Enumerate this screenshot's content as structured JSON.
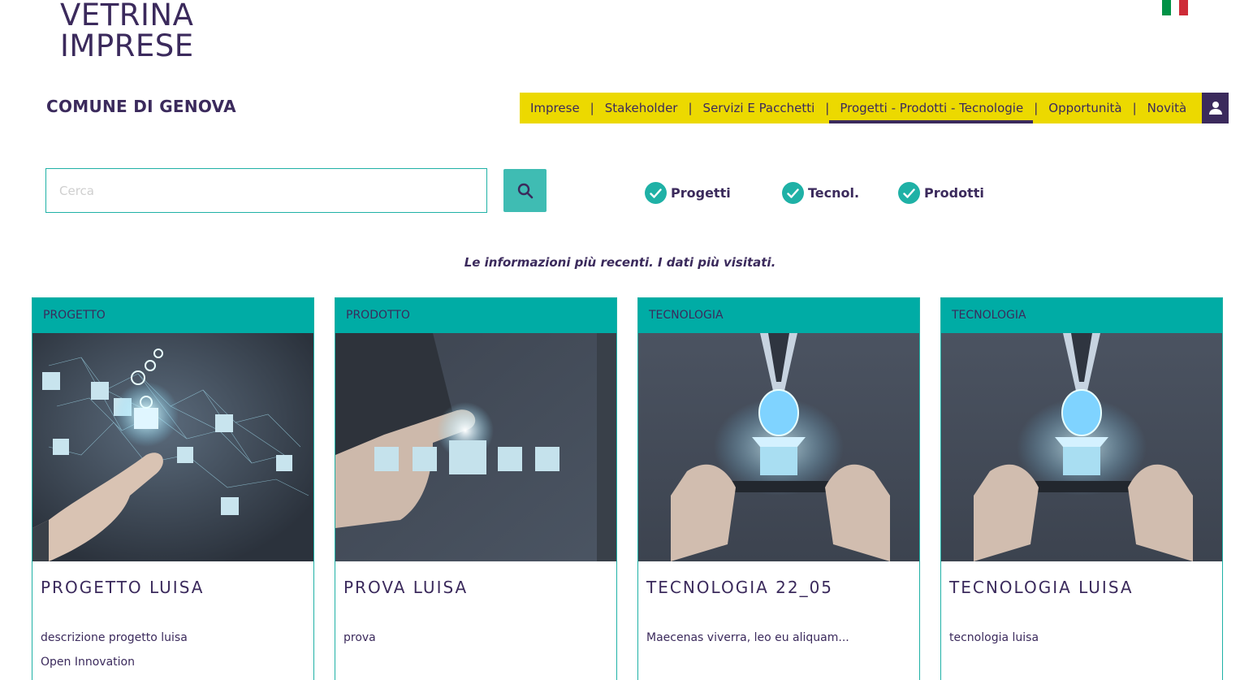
{
  "header": {
    "logo_line1": "VETRINA",
    "logo_line2": "IMPRESE",
    "comune": "COMUNE DI GENOVA",
    "flag_colors": [
      "#009246",
      "#ffffff",
      "#ce2b37"
    ]
  },
  "nav": {
    "items": [
      {
        "label": "Imprese"
      },
      {
        "label": "Stakeholder"
      },
      {
        "label": "Servizi E Pacchetti"
      },
      {
        "label": "Progetti - Prodotti - Tecnologie",
        "active": true
      },
      {
        "label": "Opportunità"
      },
      {
        "label": "Novità"
      }
    ],
    "separator": "|",
    "user_icon": "user-icon"
  },
  "search": {
    "placeholder": "Cerca",
    "value": "",
    "button_icon": "search-icon"
  },
  "filters": [
    {
      "label": "Progetti",
      "checked": true
    },
    {
      "label": "Tecnol.",
      "checked": true
    },
    {
      "label": "Prodotti",
      "checked": true
    }
  ],
  "tagline": "Le informazioni più recenti. I dati più visitati.",
  "cards": [
    {
      "category": "PROGETTO",
      "title": "PROGETTO LUISA",
      "description": "descrizione progetto luisa",
      "extra": "Open Innovation",
      "image": "hand-network-cubes-image"
    },
    {
      "category": "PRODOTTO",
      "title": "PROVA LUISA",
      "description": "prova",
      "extra": "",
      "image": "finger-pointing-cubes-image"
    },
    {
      "category": "TECNOLOGIA",
      "title": "TECNOLOGIA 22_05",
      "description": "Maecenas viverra, leo eu aliquam...",
      "extra": "",
      "image": "smartphone-globe-box-image"
    },
    {
      "category": "TECNOLOGIA",
      "title": "TECNOLOGIA LUISA",
      "description": "tecnologia luisa",
      "extra": "",
      "image": "smartphone-globe-box-image"
    }
  ],
  "colors": {
    "brand_purple": "#3b2a5c",
    "nav_yellow": "#ecd900",
    "teal": "#00aca5"
  }
}
